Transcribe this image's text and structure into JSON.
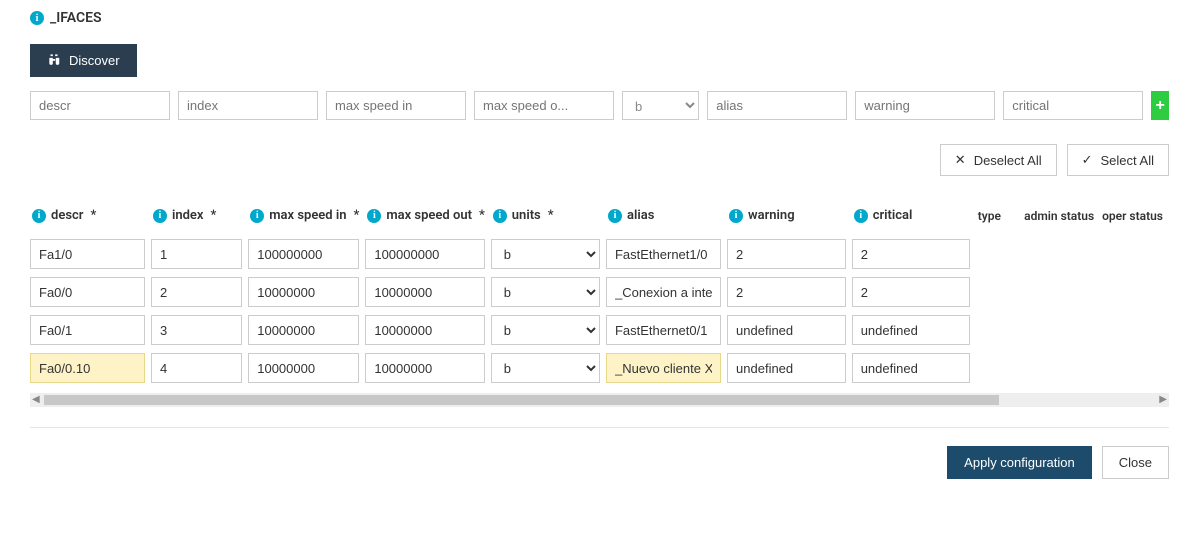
{
  "title": "_IFACES",
  "discover_label": "Discover",
  "filters": {
    "descr": "descr",
    "index": "index",
    "max_speed_in": "max speed in",
    "max_speed_out": "max speed o...",
    "units_selected": "b",
    "alias": "alias",
    "warning": "warning",
    "critical": "critical"
  },
  "deselect_all_label": "Deselect All",
  "select_all_label": "Select All",
  "columns": {
    "descr": "descr",
    "index": "index",
    "max_speed_in": "max speed in",
    "max_speed_out": "max speed out",
    "units": "units",
    "alias": "alias",
    "warning": "warning",
    "critical": "critical",
    "type": "type",
    "admin_status": "admin status",
    "oper_status": "oper status"
  },
  "rows": [
    {
      "descr": "Fa1/0",
      "index": "1",
      "max_speed_in": "100000000",
      "max_speed_out": "100000000",
      "units": "b",
      "alias": "FastEthernet1/0",
      "warning": "2",
      "critical": "2",
      "hl_descr": false,
      "hl_alias": false
    },
    {
      "descr": "Fa0/0",
      "index": "2",
      "max_speed_in": "10000000",
      "max_speed_out": "10000000",
      "units": "b",
      "alias": "_Conexion a inte...",
      "warning": "2",
      "critical": "2",
      "hl_descr": false,
      "hl_alias": false
    },
    {
      "descr": "Fa0/1",
      "index": "3",
      "max_speed_in": "10000000",
      "max_speed_out": "10000000",
      "units": "b",
      "alias": "FastEthernet0/1",
      "warning": "undefined",
      "critical": "undefined",
      "hl_descr": false,
      "hl_alias": false
    },
    {
      "descr": "Fa0/0.10",
      "index": "4",
      "max_speed_in": "10000000",
      "max_speed_out": "10000000",
      "units": "b",
      "alias": "_Nuevo cliente X...",
      "warning": "undefined",
      "critical": "undefined",
      "hl_descr": true,
      "hl_alias": true
    }
  ],
  "apply_label": "Apply configuration",
  "close_label": "Close"
}
